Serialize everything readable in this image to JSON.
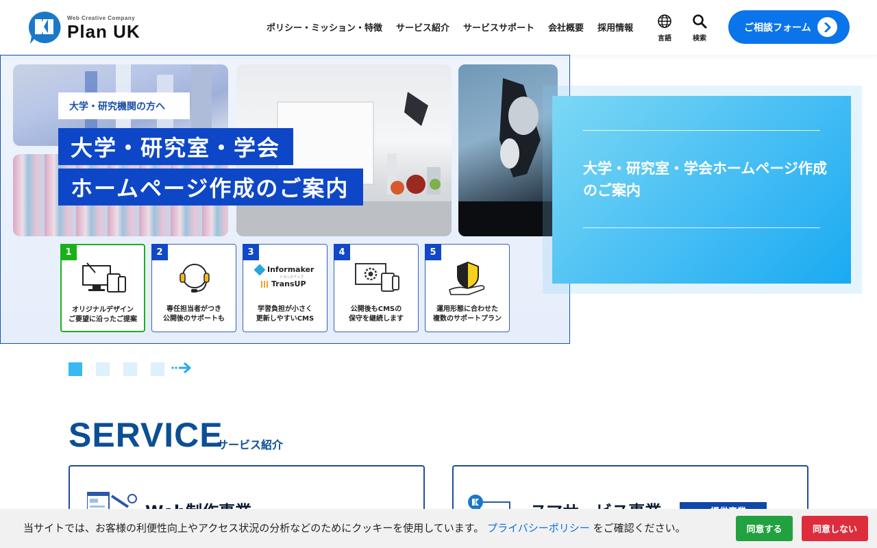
{
  "header": {
    "logo_tag": "Web Creative Company",
    "logo_name": "Plan UK",
    "nav": [
      "ポリシー・ミッション・特徴",
      "サービス紹介",
      "サービスサポート",
      "会社概要",
      "採用情報"
    ],
    "lang_label": "言語",
    "search_label": "検索",
    "contact_label": "ご相談フォーム"
  },
  "hero": {
    "sub_label": "大学・研究機関の方へ",
    "title_line1": "大学・研究室・学会",
    "title_line2": "ホームページ作成のご案内",
    "features": [
      {
        "num": "1",
        "line1": "オリジナルデザイン",
        "line2": "ご要望に沿ったご提案",
        "icon": "devices-icon"
      },
      {
        "num": "2",
        "line1": "専任担当者がつき",
        "line2": "公開後のサポートも",
        "icon": "headset-icon"
      },
      {
        "num": "3",
        "line1": "学習負担が小さく",
        "line2": "更新しやすいCMS",
        "icon": "cms-logo-icon"
      },
      {
        "num": "4",
        "line1": "公開後もCMSの",
        "line2": "保守を継続します",
        "icon": "gear-devices-icon"
      },
      {
        "num": "5",
        "line1": "運用形態に合わせた",
        "line2": "複数のサポートプラン",
        "icon": "shield-hand-icon"
      }
    ],
    "informaker": "Informaker",
    "transup": "TransUP",
    "transup_ruby": "トランスアップ"
  },
  "panel": {
    "title": "大学・研究室・学会ホームページ作成のご案内"
  },
  "service": {
    "title": "SERVICE",
    "subtitle": "サービス紹介",
    "card1_title": "Web制作事業",
    "card2_title": "スマサービス事業",
    "card2_badge": "提供事業"
  },
  "cookie": {
    "text_before": "当サイトでは、お客様の利便性向上やアクセス状況の分析などのためにクッキーを使用しています。",
    "link": "プライバシーポリシー",
    "text_after": "をご確認ください。",
    "agree": "同意する",
    "deny": "同意しない"
  },
  "colors": {
    "primary": "#0a74ea",
    "navy": "#0c4f93",
    "hero_blue": "#0d47c7",
    "panel_cyan": "#1aaaf2",
    "agree_green": "#21a13f",
    "deny_red": "#dd2d3c"
  }
}
